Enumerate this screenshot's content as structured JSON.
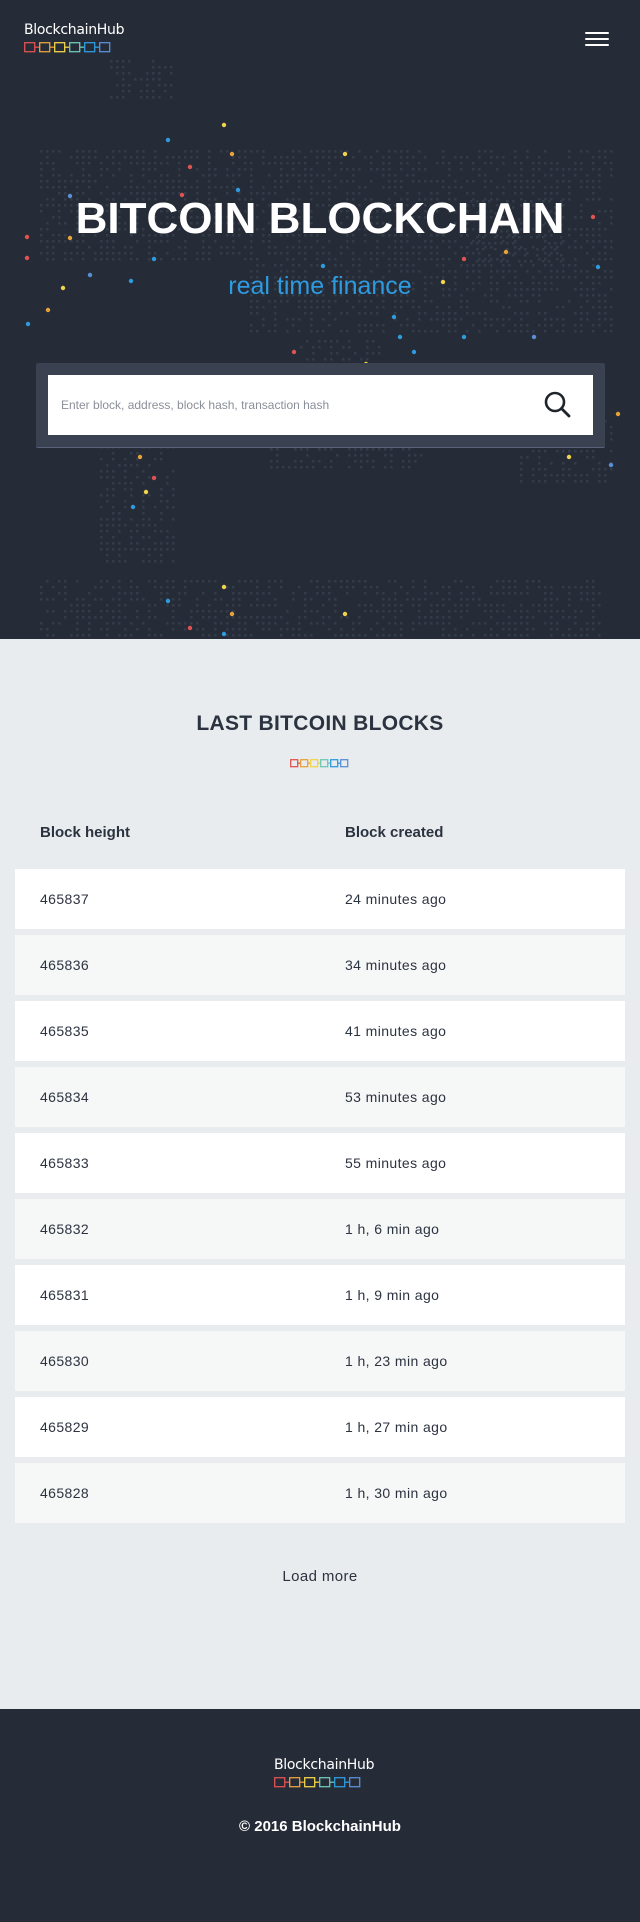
{
  "brand": {
    "name": "BlockchainHub",
    "chain_colors": [
      "#e05353",
      "#e8a23a",
      "#f0d44a",
      "#6fc7b4",
      "#2e9be0",
      "#5a8fd8"
    ]
  },
  "header": {
    "menu_icon": "hamburger-menu-icon"
  },
  "hero": {
    "title": "BITCOIN BLOCKCHAIN",
    "subtitle": "real time finance",
    "subtitle_color": "#2e9be0",
    "background_color": "#262c37"
  },
  "search": {
    "placeholder": "Enter block, address, block hash, transaction hash",
    "icon": "search-icon"
  },
  "blocks_section": {
    "title": "LAST BITCOIN BLOCKS",
    "columns": [
      "Block height",
      "Block created"
    ],
    "rows": [
      {
        "height": "465837",
        "created": "24 minutes ago"
      },
      {
        "height": "465836",
        "created": "34 minutes ago"
      },
      {
        "height": "465835",
        "created": "41 minutes ago"
      },
      {
        "height": "465834",
        "created": "53 minutes ago"
      },
      {
        "height": "465833",
        "created": "55 minutes ago"
      },
      {
        "height": "465832",
        "created": "1 h, 6 min ago"
      },
      {
        "height": "465831",
        "created": "1 h, 9 min ago"
      },
      {
        "height": "465830",
        "created": "1 h, 23 min ago"
      },
      {
        "height": "465829",
        "created": "1 h, 27 min ago"
      },
      {
        "height": "465828",
        "created": "1 h, 30 min ago"
      }
    ],
    "load_more_label": "Load more"
  },
  "footer": {
    "copyright": "© 2016 BlockchainHub"
  }
}
